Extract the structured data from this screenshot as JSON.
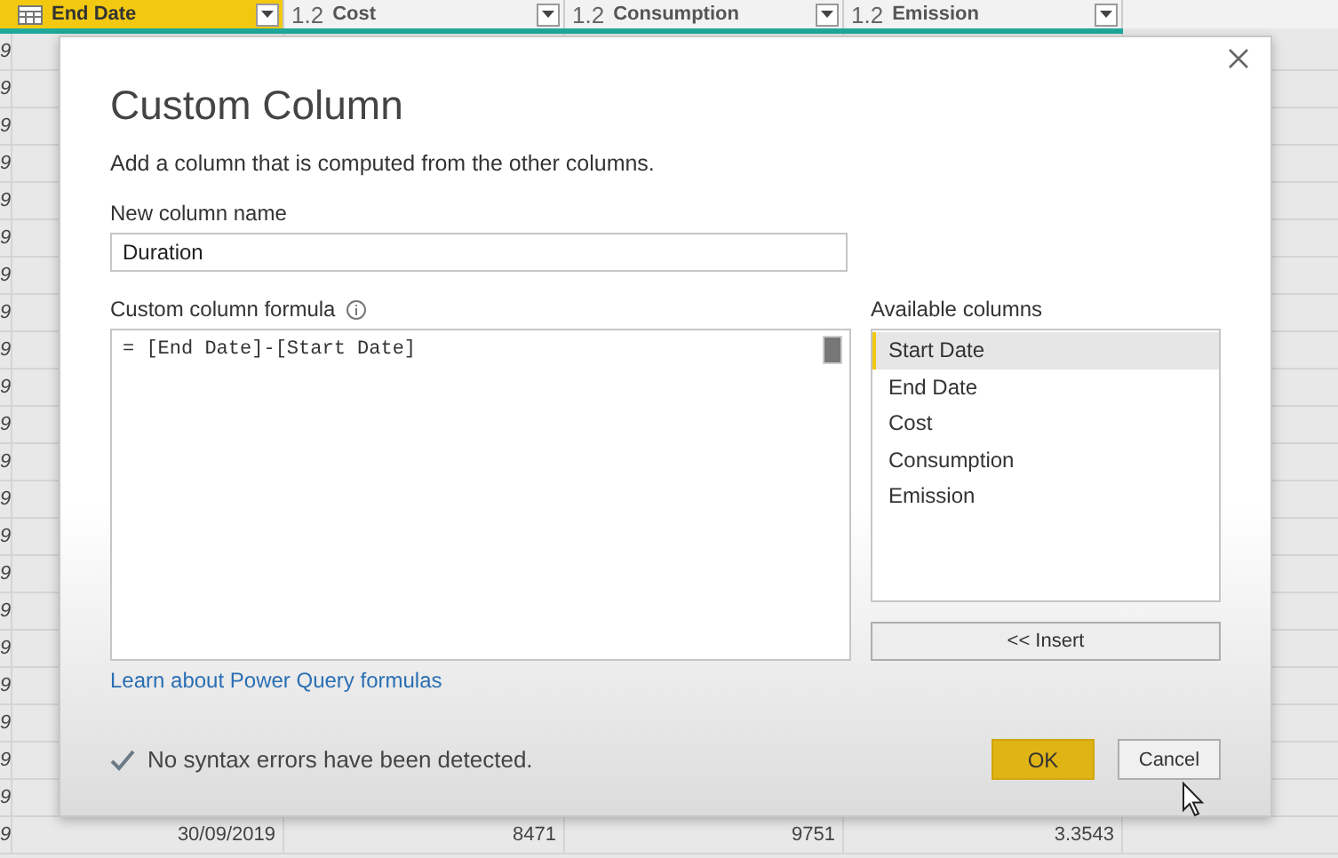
{
  "grid": {
    "columns": [
      {
        "kind": "date",
        "label": "End Date",
        "selected": true
      },
      {
        "kind": "number",
        "type_label": "1.2",
        "label": "Cost",
        "selected": false
      },
      {
        "kind": "number",
        "type_label": "1.2",
        "label": "Consumption",
        "selected": false
      },
      {
        "kind": "number",
        "type_label": "1.2",
        "label": "Emission",
        "selected": false
      }
    ],
    "rows": [
      [
        "9"
      ],
      [
        "9"
      ],
      [
        "9"
      ],
      [
        "9"
      ],
      [
        "9"
      ],
      [
        "9"
      ],
      [
        "9"
      ],
      [
        "9"
      ],
      [
        "9"
      ],
      [
        "9"
      ],
      [
        "9"
      ],
      [
        "9"
      ],
      [
        "9"
      ],
      [
        "9"
      ],
      [
        "9"
      ],
      [
        "9"
      ],
      [
        "9"
      ],
      [
        "9"
      ],
      [
        "9"
      ],
      [
        "9"
      ],
      [
        "9"
      ],
      [
        "9",
        "30/09/2019",
        "8471",
        "9751",
        "3.3543"
      ]
    ]
  },
  "dialog": {
    "title": "Custom Column",
    "description": "Add a column that is computed from the other columns.",
    "name_label": "New column name",
    "name_value": "Duration",
    "formula_label": "Custom column formula",
    "formula": "= [End Date]-[Start Date]",
    "available_label": "Available columns",
    "available_columns": [
      {
        "label": "Start Date",
        "selected": true
      },
      {
        "label": "End Date",
        "selected": false
      },
      {
        "label": "Cost",
        "selected": false
      },
      {
        "label": "Consumption",
        "selected": false
      },
      {
        "label": "Emission",
        "selected": false
      }
    ],
    "insert_button": "<< Insert",
    "learn_link": "Learn about Power Query formulas",
    "status": "No syntax errors have been detected.",
    "ok_button": "OK",
    "cancel_button": "Cancel"
  }
}
